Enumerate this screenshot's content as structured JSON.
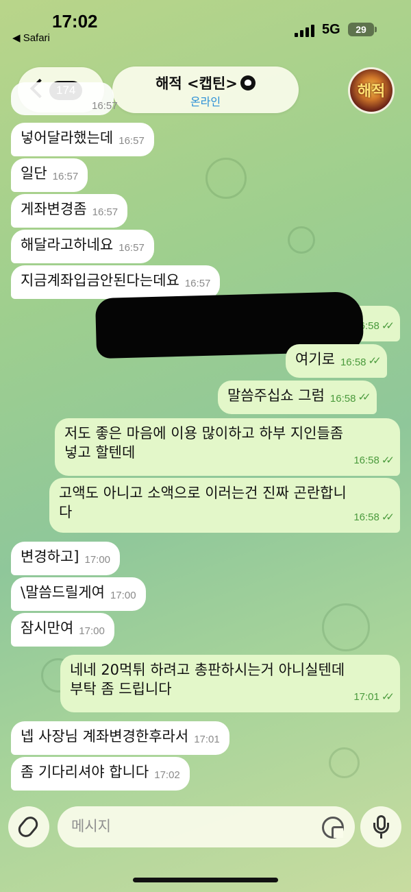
{
  "status_bar": {
    "time": "17:02",
    "back_app": "◀ Safari",
    "network": "5G",
    "battery": "29"
  },
  "header": {
    "unread_count": "174",
    "title": "해적 <캡틴>",
    "status": "온라인",
    "avatar_text": "해적"
  },
  "partial_time": "16:57",
  "messages": [
    {
      "dir": "in",
      "text": "넣어달라했는데",
      "time": "16:57"
    },
    {
      "dir": "in",
      "text": "일단",
      "time": "16:57"
    },
    {
      "dir": "in",
      "text": "게좌변경좀",
      "time": "16:57"
    },
    {
      "dir": "in",
      "text": "해달라고하네요",
      "time": "16:57"
    },
    {
      "dir": "in",
      "text": "지금계좌입금안된다는데요",
      "time": "16:57"
    },
    {
      "dir": "out",
      "text": "",
      "time": "16:58"
    },
    {
      "dir": "out",
      "text": "여기로",
      "time": "16:58"
    },
    {
      "dir": "out",
      "text": "말씀주십쇼 그럼",
      "time": "16:58"
    },
    {
      "dir": "out",
      "text": "저도 좋은 마음에 이용 많이하고 하부 지인들좀 넣고 할텐데",
      "time": "16:58"
    },
    {
      "dir": "out",
      "text": "고액도 아니고 소액으로 이러는건 진짜 곤란합니다",
      "time": "16:58"
    },
    {
      "dir": "in",
      "text": "변경하고]",
      "time": "17:00"
    },
    {
      "dir": "in",
      "text": "\\말씀드릴게여",
      "time": "17:00"
    },
    {
      "dir": "in",
      "text": "잠시만여",
      "time": "17:00"
    },
    {
      "dir": "out",
      "text": "네네 20먹튀 하려고 총판하시는거 아니실텐데 부탁 좀 드립니다",
      "time": "17:01"
    },
    {
      "dir": "in",
      "text": "넵 사장님 계좌변경한후라서",
      "time": "17:01"
    },
    {
      "dir": "in",
      "text": "좀 기다리셔야 합니다",
      "time": "17:02"
    }
  ],
  "lines": {
    "m8a": "저도 좋은 마음에 이용 많이하고 하부 지인들좀",
    "m8b": "넣고 할텐데",
    "m9a": "고액도 아니고 소액으로 이러는건 진짜 곤란합니",
    "m9b": "다",
    "m13a": "네네 20먹튀 하려고 총판하시는거 아니실텐데",
    "m13b": "부탁 좀 드립니다"
  },
  "input": {
    "placeholder": "메시지"
  },
  "colors": {
    "incoming": "#ffffff",
    "outgoing": "#e3f7c9",
    "accent": "#2a8fd6",
    "check": "#4a9a3c"
  }
}
